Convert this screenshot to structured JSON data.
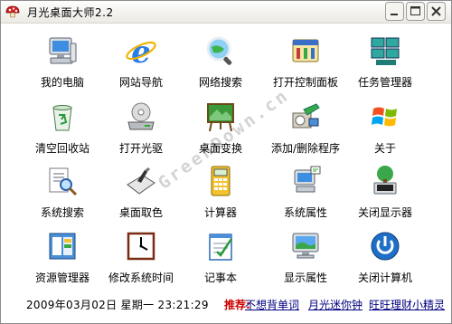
{
  "window": {
    "title": "月光桌面大师2.2"
  },
  "items": [
    {
      "label": "我的电脑",
      "icon": "computer-icon"
    },
    {
      "label": "网站导航",
      "icon": "internet-explorer-icon"
    },
    {
      "label": "网络搜索",
      "icon": "web-search-icon"
    },
    {
      "label": "打开控制面板",
      "icon": "control-panel-icon"
    },
    {
      "label": "任务管理器",
      "icon": "task-manager-icon"
    },
    {
      "label": "清空回收站",
      "icon": "recycle-bin-icon"
    },
    {
      "label": "打开光驱",
      "icon": "cd-drive-icon"
    },
    {
      "label": "桌面变换",
      "icon": "desktop-change-icon"
    },
    {
      "label": "添加/删除程序",
      "icon": "add-remove-programs-icon"
    },
    {
      "label": "关于",
      "icon": "windows-logo-icon"
    },
    {
      "label": "系统搜索",
      "icon": "system-search-icon"
    },
    {
      "label": "桌面取色",
      "icon": "color-picker-icon"
    },
    {
      "label": "计算器",
      "icon": "calculator-icon"
    },
    {
      "label": "系统属性",
      "icon": "system-properties-icon"
    },
    {
      "label": "关闭显示器",
      "icon": "monitor-off-icon"
    },
    {
      "label": "资源管理器",
      "icon": "explorer-icon"
    },
    {
      "label": "修改系统时间",
      "icon": "clock-icon"
    },
    {
      "label": "记事本",
      "icon": "notepad-icon"
    },
    {
      "label": "显示属性",
      "icon": "display-properties-icon"
    },
    {
      "label": "关闭计算机",
      "icon": "power-icon"
    }
  ],
  "status": {
    "datetime": "2009年03月02日 星期一 23:21:29",
    "recommend_label": "推荐:",
    "links": [
      "不想背单词",
      "月光迷你钟",
      "旺旺理财小精灵"
    ]
  },
  "watermark": "GreenDown.cn"
}
